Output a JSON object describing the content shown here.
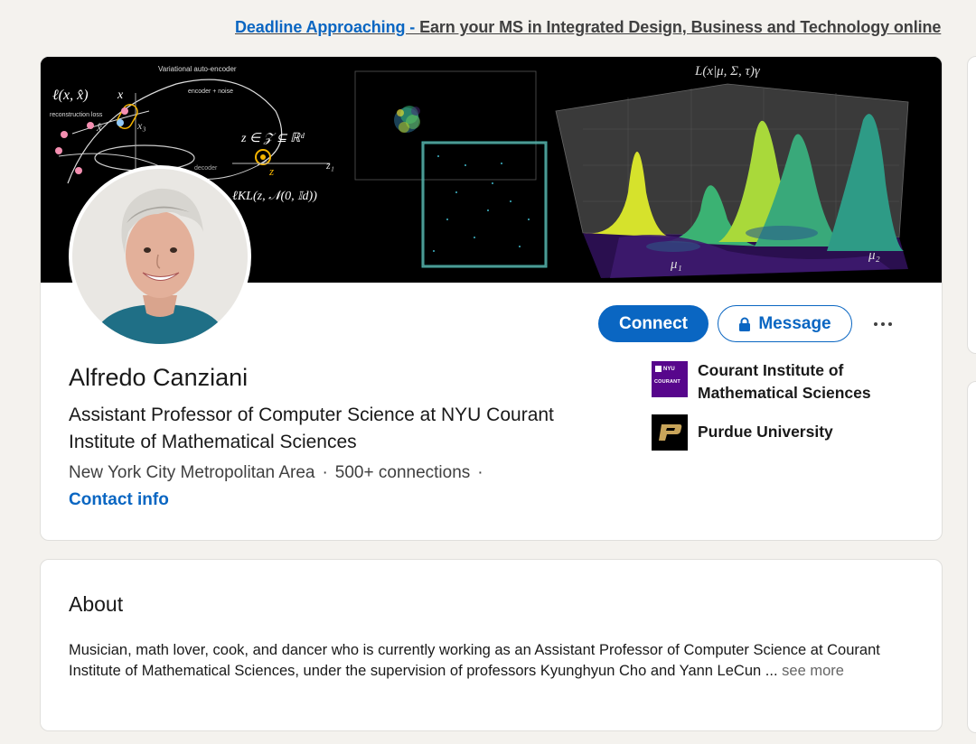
{
  "ad": {
    "link_text": "Deadline Approaching - ",
    "text": "Earn your MS in Integrated Design, Business and Technology online"
  },
  "banner": {
    "vae_title": "Variational auto-encoder",
    "encoder_label": "encoder + noise",
    "decoder_label": "decoder",
    "recon_label": "reconstruction loss",
    "loss_formula": "ℓ(x, x̂)",
    "x_label": "x",
    "xhat_label": "x̂",
    "x3_label": "x₃",
    "z_label": "z",
    "z1_label": "z₁",
    "set_formula": "z ∈ 𝒵 ⊆ ℝᵈ",
    "kl_formula": "ℓKL(z, 𝒩(0, 𝕀d))",
    "surface_formula": "L(x|μ, Σ, τ)γ",
    "mu1_label": "μ₁",
    "mu2_label": "μ₂"
  },
  "profile": {
    "name": "Alfredo Canziani",
    "headline": "Assistant Professor of Computer Science at NYU Courant Institute of Mathematical Sciences",
    "location": "New York City Metropolitan Area",
    "connections": "500+ connections",
    "separator": "·",
    "contact_info": "Contact info"
  },
  "actions": {
    "connect": "Connect",
    "message": "Message"
  },
  "orgs": [
    {
      "name": "Courant Institute of Mathematical Sciences",
      "logo_top": "NYU",
      "logo_bottom": "COURANT"
    },
    {
      "name": "Purdue University",
      "logo_text": "P"
    }
  ],
  "about": {
    "title": "About",
    "text": "Musician, math lover, cook, and dancer who is currently working as an Assistant Professor of Computer Science at Courant Institute of Mathematical Sciences, under the supervision of professors Kyunghyun Cho and Yann LeCun",
    "ellipsis": "...",
    "see_more": "see more"
  },
  "colors": {
    "accent": "#0a66c2",
    "page_bg": "#f4f2ee",
    "nyu_purple": "#57068c"
  }
}
